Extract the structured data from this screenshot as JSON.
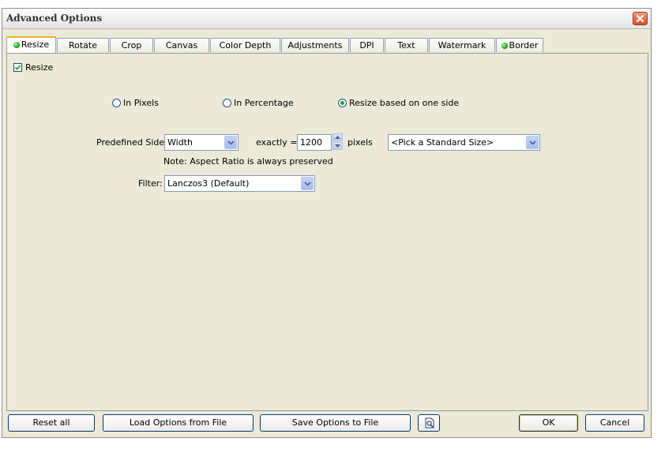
{
  "window": {
    "title": "Advanced Options"
  },
  "tabs": [
    {
      "label": "Resize",
      "active": true,
      "status_dot": true
    },
    {
      "label": "Rotate"
    },
    {
      "label": "Crop"
    },
    {
      "label": "Canvas"
    },
    {
      "label": "Color Depth"
    },
    {
      "label": "Adjustments"
    },
    {
      "label": "DPI"
    },
    {
      "label": "Text"
    },
    {
      "label": "Watermark"
    },
    {
      "label": "Border",
      "status_dot": true
    }
  ],
  "resize": {
    "enable_label": "Resize",
    "enabled": true,
    "mode_options": [
      "In Pixels",
      "In Percentage",
      "Resize based on one side"
    ],
    "selected_mode": "Resize based on one side",
    "predefined_side_label": "Predefined Side:",
    "predefined_side_value": "Width",
    "exactly_label": "exactly =",
    "size_value": "1200",
    "units_label": "pixels",
    "standard_size_value": "<Pick a Standard Size>",
    "note": "Note: Aspect Ratio is always preserved",
    "filter_label": "Filter:",
    "filter_value": "Lanczos3 (Default)"
  },
  "footer": {
    "reset_label": "Reset all",
    "load_label": "Load Options from File",
    "save_label": "Save Options to File",
    "preview_icon": "preview-icon",
    "ok_label": "OK",
    "cancel_label": "Cancel"
  },
  "colors": {
    "dialog_bg": "#ece9d8",
    "active_tab_accent": "#f4b33c",
    "status_dot": "#1aa51a",
    "close_button": "#d5512c"
  }
}
